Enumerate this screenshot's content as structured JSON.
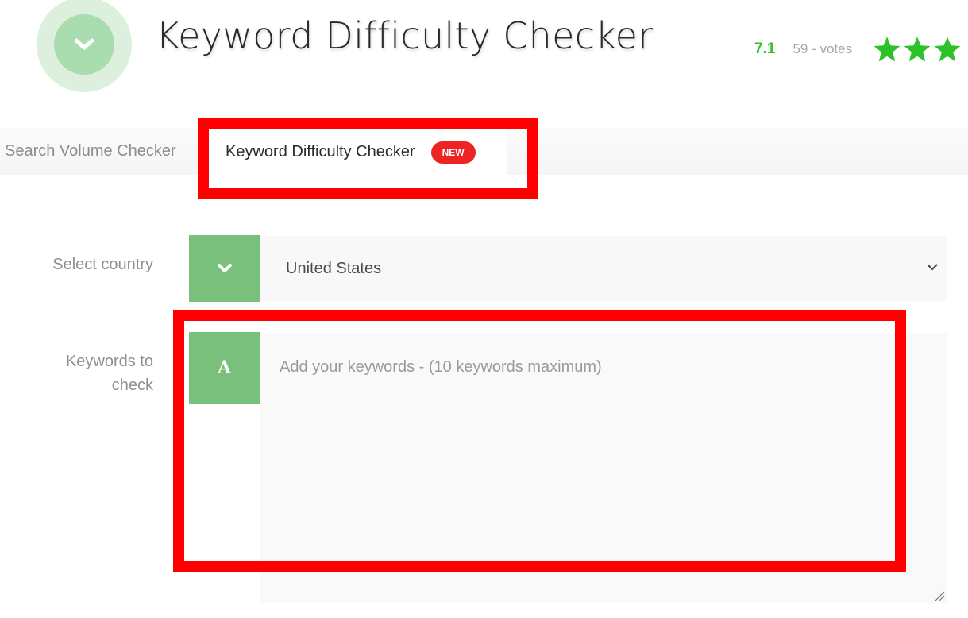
{
  "header": {
    "logo_icon": "chevron-down-icon",
    "title": "Keyword Difficulty Checker",
    "rating": {
      "score": "7.1",
      "votes": "59 - votes",
      "stars_visible": 3,
      "star_color": "#2ec22a"
    }
  },
  "tabs": [
    {
      "label": "Search Volume Checker",
      "active": false
    },
    {
      "label": "Keyword Difficulty Checker",
      "active": true,
      "badge": "NEW"
    }
  ],
  "form": {
    "country": {
      "label": "Select country",
      "icon": "chevron-down-icon",
      "selected": "United States"
    },
    "keywords": {
      "label": "Keywords to check",
      "icon_letter": "A",
      "value": "",
      "placeholder": "Add your keywords - (10 keywords maximum)"
    }
  },
  "colors": {
    "accent_green": "#79c07c",
    "highlight_red": "#ff0000",
    "badge_red": "#ee2424"
  }
}
